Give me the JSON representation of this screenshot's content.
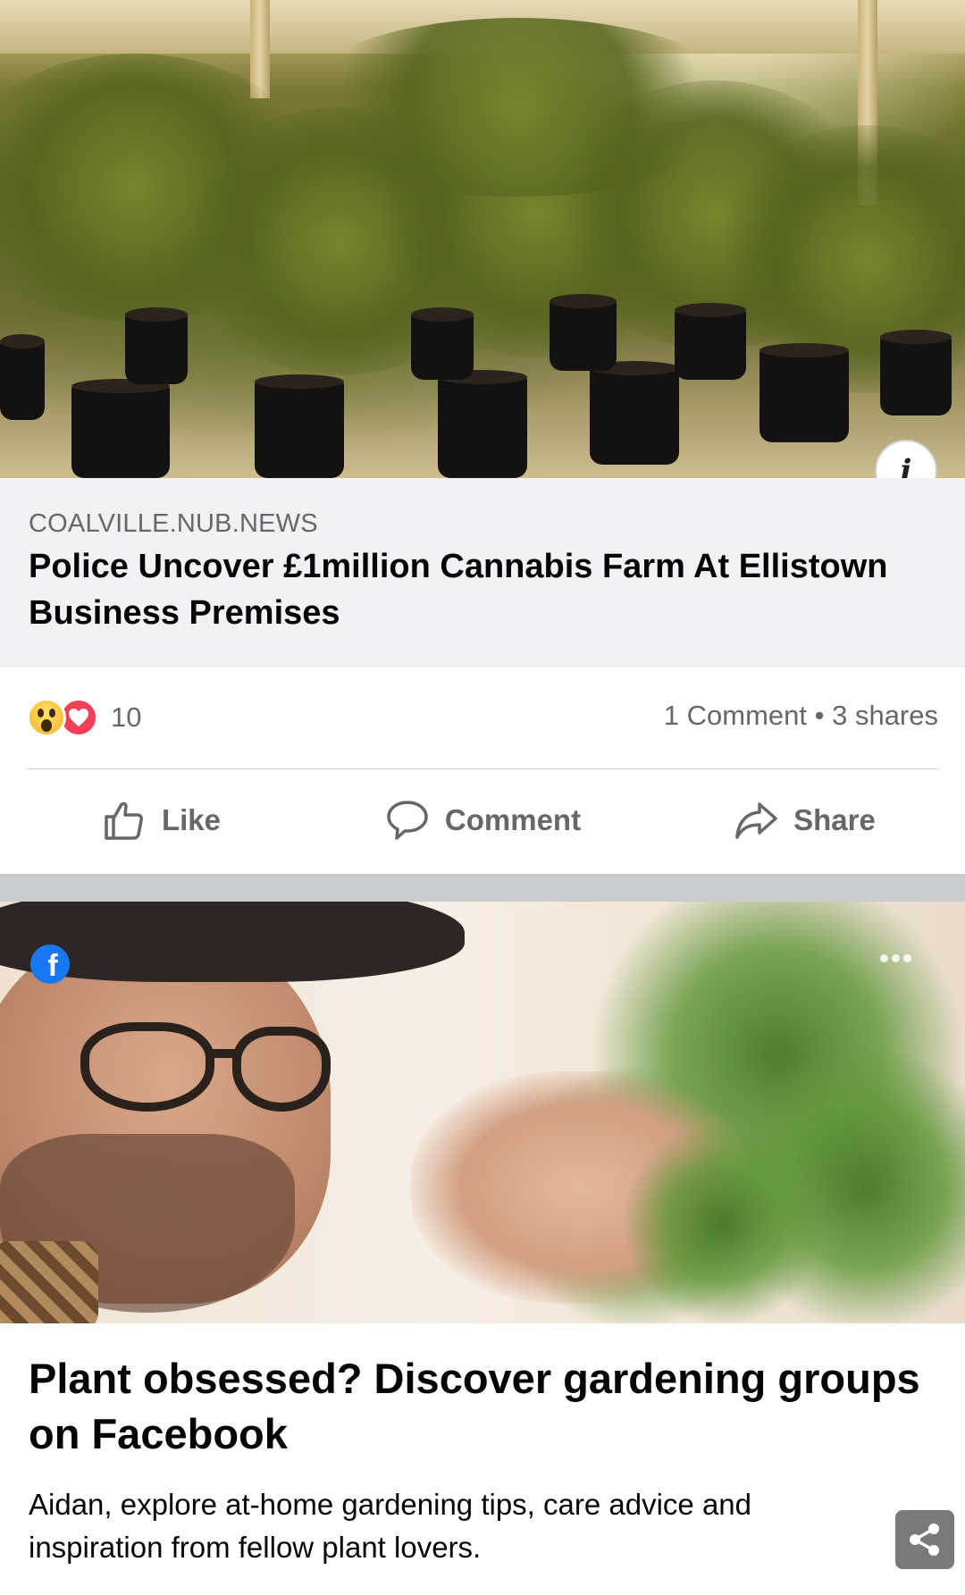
{
  "post1": {
    "link": {
      "domain": "COALVILLE.NUB.NEWS",
      "title": "Police Uncover £1million Cannabis Farm At Ellistown Business Premises"
    },
    "info_button_label": "i",
    "reactions": {
      "icons": [
        "wow-icon",
        "love-icon"
      ],
      "count": "10"
    },
    "engagement": "1 Comment • 3 shares",
    "actions": {
      "like": "Like",
      "comment": "Comment",
      "share": "Share"
    }
  },
  "post2": {
    "badge_icon": "facebook-icon",
    "badge_letter": "f",
    "headline": "Plant obsessed? Discover gardening groups on Facebook",
    "body": "Aidan, explore at-home gardening tips, care advice and inspiration from fellow plant lovers.",
    "share_icon": "share-icon"
  },
  "colors": {
    "facebook_blue": "#1877f2",
    "secondary_text": "#65676b",
    "separator": "#c9ccd1",
    "link_preview_bg": "#f0f2f5",
    "love_red": "#f33e58",
    "wow_yellow": "#f7b125"
  }
}
